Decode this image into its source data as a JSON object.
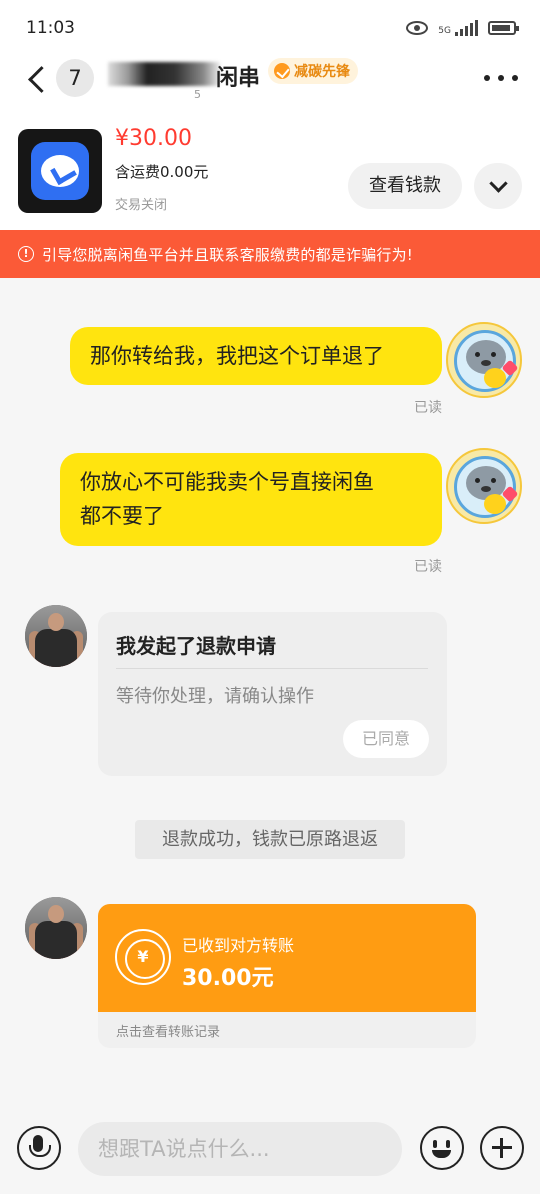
{
  "status_bar": {
    "time": "11:03",
    "network": "5G"
  },
  "header": {
    "unread_count": "7",
    "nickname_visible": "闲串",
    "nickname_sub": "5",
    "badge_label": "减碳先锋"
  },
  "order": {
    "price": "¥30.00",
    "shipping": "含运费0.00元",
    "status": "交易关闭",
    "view_payment_label": "查看钱款"
  },
  "warning": {
    "icon": "!",
    "text": "引导您脱离闲鱼平台并且联系客服缴费的都是诈骗行为!"
  },
  "messages": {
    "m1": {
      "text": "那你转给我，我把这个订单退了",
      "read": "已读"
    },
    "m2": {
      "line1": "你放心不可能我卖个号直接闲鱼",
      "line2": "都不要了",
      "read": "已读"
    },
    "refund": {
      "title": "我发起了退款申请",
      "desc": "等待你处理，请确认操作",
      "agreed_label": "已同意"
    },
    "system": {
      "text": "退款成功，钱款已原路退返"
    },
    "transfer": {
      "currency_symbol": "¥",
      "label": "已收到对方转账",
      "amount": "30.00元",
      "link": "点击查看转账记录"
    }
  },
  "input": {
    "placeholder": "想跟TA说点什么..."
  },
  "colors": {
    "accent_yellow": "#ffe40f",
    "warning_red": "#fb5a37",
    "price_red": "#ff3b30",
    "transfer_orange": "#ff9c12"
  },
  "icons": {
    "back": "chevron-left-icon",
    "more": "more-dots-icon",
    "expand": "chevron-down-icon",
    "voice": "microphone-icon",
    "emoji": "smiley-icon",
    "plus": "plus-circle-icon",
    "transfer": "yuan-circle-icon"
  }
}
